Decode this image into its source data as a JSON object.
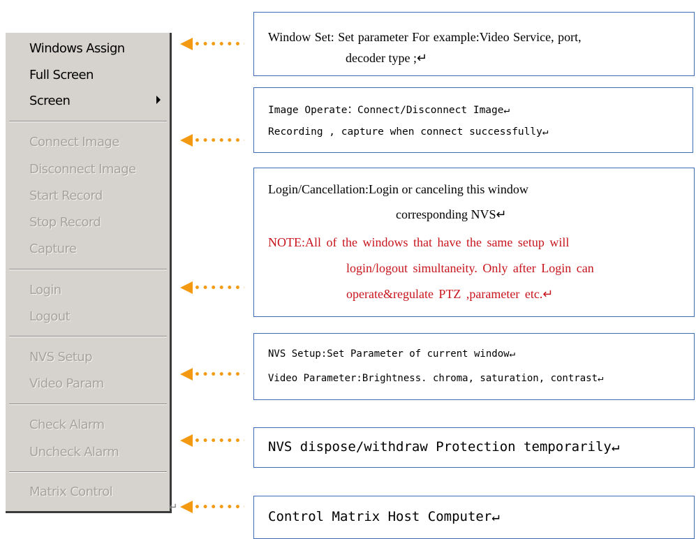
{
  "menu": {
    "items": [
      {
        "label": "Windows Assign",
        "enabled": true
      },
      {
        "label": "Full Screen",
        "enabled": true
      },
      {
        "label": "Screen",
        "enabled": true,
        "submenu": true
      },
      {
        "label": "Connect Image",
        "enabled": false
      },
      {
        "label": "Disconnect Image",
        "enabled": false
      },
      {
        "label": "Start Record",
        "enabled": false
      },
      {
        "label": "Stop Record",
        "enabled": false
      },
      {
        "label": "Capture",
        "enabled": false
      },
      {
        "label": "Login",
        "enabled": false
      },
      {
        "label": "Logout",
        "enabled": false
      },
      {
        "label": "NVS  Setup",
        "enabled": false
      },
      {
        "label": "Video Param",
        "enabled": false
      },
      {
        "label": "Check Alarm",
        "enabled": false
      },
      {
        "label": "Uncheck Alarm",
        "enabled": false
      },
      {
        "label": "Matrix Control",
        "enabled": false
      }
    ]
  },
  "boxes": [
    {
      "lines": [
        "Window Set: Set parameter   For   example:Video Service, port,",
        "decoder   type ;↵"
      ]
    },
    {
      "lines": [
        "Image Operate：Connect/Disconnect Image↵",
        "Recording , capture when connect successfully↵"
      ]
    },
    {
      "lines": [
        "Login/Cancellation:Login      or      canceling      this      window",
        "corresponding NVS↵",
        "NOTE:All of the windows that have the same setup will",
        "login/logout simultaneity. Only   after Login can",
        "operate&regulate   PTZ ,parameter   etc.↵"
      ]
    },
    {
      "lines": [
        "NVS Setup:Set Parameter of current window↵",
        "Video Parameter:Brightness. chroma, saturation, contrast↵"
      ]
    },
    {
      "lines": [
        "NVS dispose/withdraw Protection temporarily↵"
      ]
    },
    {
      "lines": [
        "Control Matrix Host Computer↵"
      ]
    }
  ],
  "colors": {
    "menu_bg": "#d6d3ce",
    "disabled_text": "#a7a49e",
    "arrow": "#f39a12",
    "box_border": "#3b6bb5",
    "note_text": "#c8141c"
  },
  "icons": {
    "submenu": "triangle-right-icon",
    "pointer": "dotted-arrow-left-icon"
  }
}
